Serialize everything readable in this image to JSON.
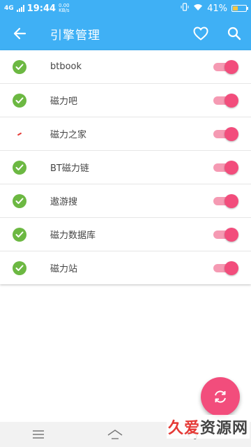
{
  "status_bar": {
    "network": "4G",
    "time": "19:44",
    "speed_value": "0.00",
    "speed_unit": "KB/s",
    "battery_percent": "41%",
    "battery_level": 0.41
  },
  "app_bar": {
    "title": "引擎管理",
    "back_icon": "arrow-back-icon",
    "favorite_icon": "heart-outline-icon",
    "search_icon": "search-icon"
  },
  "engines": [
    {
      "name": "btbook",
      "status": "ok",
      "enabled": true
    },
    {
      "name": "磁力吧",
      "status": "ok",
      "enabled": true
    },
    {
      "name": "磁力之家",
      "status": "error",
      "enabled": true
    },
    {
      "name": "BT磁力链",
      "status": "ok",
      "enabled": true
    },
    {
      "name": "遨游搜",
      "status": "ok",
      "enabled": true
    },
    {
      "name": "磁力数据库",
      "status": "ok",
      "enabled": true
    },
    {
      "name": "磁力站",
      "status": "ok",
      "enabled": true
    }
  ],
  "fab": {
    "icon": "refresh-icon"
  },
  "watermark": {
    "part1": "久爱",
    "part2": "资源网"
  },
  "colors": {
    "primary": "#3fb0f5",
    "accent": "#f24d7c",
    "switch_track": "#f59ab3",
    "check_green": "#6cb842"
  }
}
